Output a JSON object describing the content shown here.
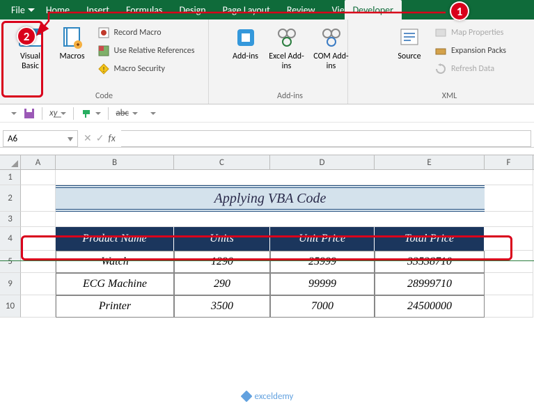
{
  "menu": {
    "tabs": [
      "File",
      "Home",
      "Insert",
      "Formulas",
      "Design",
      "Page Layout",
      "Review",
      "View",
      "Developer"
    ],
    "active_index": 8
  },
  "callouts": {
    "c1": "1",
    "c2": "2"
  },
  "ribbon": {
    "code": {
      "visual_basic": "Visual Basic",
      "macros": "Macros",
      "record_macro": "Record Macro",
      "use_relative": "Use Relative References",
      "macro_security": "Macro Security",
      "label": "Code"
    },
    "addins": {
      "addins": "Add-ins",
      "excel_addins": "Excel Add-ins",
      "com_addins": "COM Add-ins",
      "label": "Add-ins"
    },
    "xml": {
      "source": "Source",
      "map_props": "Map Properties",
      "expansion_packs": "Expansion Packs",
      "refresh_data": "Refresh Data",
      "label": "XML"
    }
  },
  "qat": {
    "xy": "x͟y",
    "abc": "abc"
  },
  "formula_bar": {
    "namebox": "A6",
    "fx": "fx",
    "value": ""
  },
  "grid": {
    "cols": [
      "A",
      "B",
      "C",
      "D",
      "E",
      "F"
    ],
    "title": "Applying VBA Code",
    "headers": {
      "b": "Product Name",
      "c": "Units",
      "d": "Unit Price",
      "e": "Total Price"
    },
    "rows": [
      {
        "n": "5",
        "b": "Watch",
        "c": "1290",
        "d": "25999",
        "e": "33538710"
      },
      {
        "n": "9",
        "b": "ECG Machine",
        "c": "290",
        "d": "99999",
        "e": "28999710"
      },
      {
        "n": "10",
        "b": "Printer",
        "c": "3500",
        "d": "7000",
        "e": "24500000"
      }
    ],
    "row_nums_pre": [
      "1",
      "2",
      "3",
      "4"
    ]
  },
  "watermark": "exceldemy"
}
